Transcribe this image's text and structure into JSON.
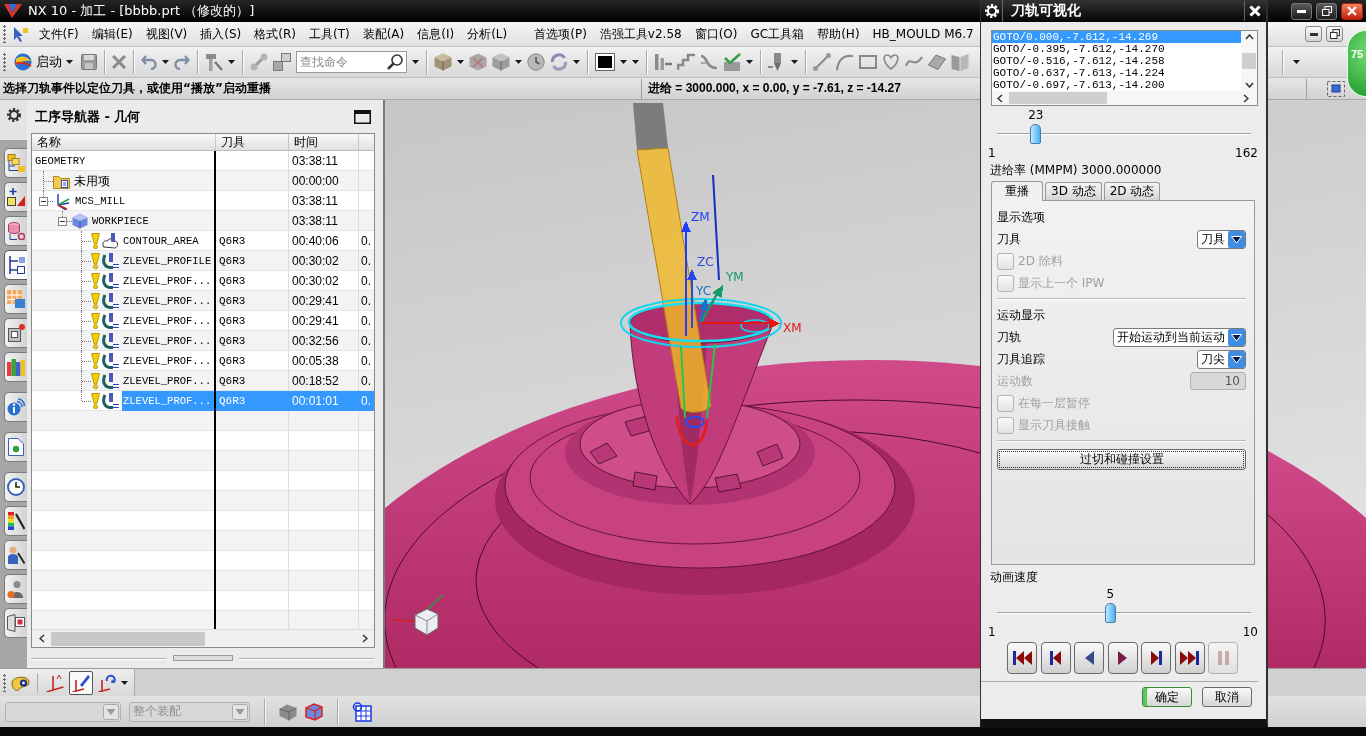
{
  "title_bar": {
    "title": "NX 10 - 加工 - [bbbb.prt （修改的）]"
  },
  "menu_bar": {
    "items": [
      "文件(F)",
      "编辑(E)",
      "视图(V)",
      "插入(S)",
      "格式(R)",
      "工具(T)",
      "装配(A)",
      "信息(I)",
      "分析(L)",
      "首选项(P)",
      "浩强工具v2.58",
      "窗口(O)",
      "GC工具箱",
      "帮助(H)",
      "HB_MOULD M6.7"
    ]
  },
  "badge": "75",
  "toolbar": {
    "start_label": "启动",
    "search": {
      "placeholder": "查找命令"
    }
  },
  "cue_line": {
    "prompt": "选择刀轨事件以定位刀具，或使用“播放”启动重播",
    "readout": "进给 = 3000.000, x = 0.00, y = -7.61, z = -14.27"
  },
  "resource_bar": {
    "groups": [
      [
        {
          "kind": "assembly",
          "selected": false
        },
        {
          "kind": "constraints",
          "selected": false
        },
        {
          "kind": "part",
          "selected": false
        },
        {
          "kind": "operation",
          "selected": true
        },
        {
          "kind": "machine",
          "selected": false
        },
        {
          "kind": "tool",
          "selected": false
        },
        {
          "kind": "library",
          "selected": false
        }
      ],
      [
        {
          "kind": "info",
          "selected": false
        }
      ],
      [
        {
          "kind": "document",
          "selected": false
        }
      ],
      [
        {
          "kind": "history",
          "selected": false
        },
        {
          "kind": "palette",
          "selected": false
        },
        {
          "kind": "role",
          "selected": false
        },
        {
          "kind": "system",
          "selected": false
        },
        {
          "kind": "web",
          "selected": false
        }
      ]
    ]
  },
  "navigator": {
    "title": "工序导航器 - 几何",
    "columns": [
      "名称",
      "刀具",
      "时间"
    ],
    "rows": [
      {
        "name": "GEOMETRY",
        "time": "03:38:11",
        "selected": false,
        "children": [
          {
            "kind": "folder",
            "name": "未用项",
            "time": "00:00:00",
            "selected": false
          },
          {
            "kind": "mcs",
            "name": "MCS_MILL",
            "time": "03:38:11",
            "expanded": true,
            "selected": false,
            "children": [
              {
                "kind": "workpiece",
                "name": "WORKPIECE",
                "time": "03:38:11",
                "expanded": true,
                "selected": false,
                "children": [
                  {
                    "kind": "contour_area",
                    "name": "CONTOUR_AREA",
                    "tool": "Q6R3",
                    "time": "00:40:06",
                    "column_4": "0.",
                    "selected": false
                  },
                  {
                    "kind": "zlevel",
                    "name": "ZLEVEL_PROFILE",
                    "tool": "Q6R3",
                    "time": "00:30:02",
                    "column_4": "0.",
                    "selected": false
                  },
                  {
                    "kind": "zlevel",
                    "name": "ZLEVEL_PROF...",
                    "tool": "Q6R3",
                    "time": "00:30:02",
                    "column_4": "0.",
                    "selected": false
                  },
                  {
                    "kind": "zlevel",
                    "name": "ZLEVEL_PROF...",
                    "tool": "Q6R3",
                    "time": "00:29:41",
                    "column_4": "0.",
                    "selected": false
                  },
                  {
                    "kind": "zlevel",
                    "name": "ZLEVEL_PROF...",
                    "tool": "Q6R3",
                    "time": "00:29:41",
                    "column_4": "0.",
                    "selected": false
                  },
                  {
                    "kind": "zlevel",
                    "name": "ZLEVEL_PROF...",
                    "tool": "Q6R3",
                    "time": "00:32:56",
                    "column_4": "0.",
                    "selected": false
                  },
                  {
                    "kind": "zlevel",
                    "name": "ZLEVEL_PROF...",
                    "tool": "Q6R3",
                    "time": "00:05:38",
                    "column_4": "0.",
                    "selected": false
                  },
                  {
                    "kind": "zlevel",
                    "name": "ZLEVEL_PROF...",
                    "tool": "Q6R3",
                    "time": "00:18:52",
                    "column_4": "0.",
                    "selected": false
                  },
                  {
                    "kind": "zlevel",
                    "name": "ZLEVEL_PROF...",
                    "tool": "Q6R3",
                    "time": "00:01:01",
                    "column_4": "0.",
                    "selected": true
                  }
                ]
              }
            ]
          }
        ]
      }
    ]
  },
  "viewport": {
    "axes": [
      {
        "label": "ZM",
        "color": "#1f3cff"
      },
      {
        "label": "ZC",
        "color": "#2a48e8"
      },
      {
        "label": "YM",
        "color": "#159a6a"
      },
      {
        "label": "YC",
        "color": "#1a70c8"
      },
      {
        "label": "XM",
        "color": "#e01818"
      }
    ]
  },
  "view_toolbar": {
    "tools": [
      {
        "kind": "palette",
        "selected": false
      },
      {
        "kind": "wcs",
        "selected": false
      },
      {
        "kind": "wcs_dynamic",
        "selected": true
      },
      {
        "kind": "wcs_rotate",
        "selected": false
      }
    ]
  },
  "selection_bar": {
    "filters": [
      {
        "disabled": true
      },
      {
        "value": "整个装配",
        "disabled": true
      }
    ]
  },
  "dialog": {
    "title": "刀轨可视化",
    "motions": [
      {
        "text": "GOTO/0.000,-7.612,-14.269",
        "selected": true
      },
      {
        "text": "GOTO/-0.395,-7.612,-14.270",
        "selected": false
      },
      {
        "text": "GOTO/-0.516,-7.612,-14.258",
        "selected": false
      },
      {
        "text": "GOTO/-0.637,-7.613,-14.224",
        "selected": false
      },
      {
        "text": "GOTO/-0.697,-7.613,-14.200",
        "selected": false
      }
    ],
    "motion_slider": {
      "value": "23",
      "min": "1",
      "max": "162",
      "level": 0.137
    },
    "feed_rate": "进给率 (MMPM) 3000.000000",
    "tabs": [
      {
        "label": "重播",
        "selected": true
      },
      {
        "label": "3D 动态",
        "selected": false
      },
      {
        "label": "2D 动态",
        "selected": false
      }
    ],
    "panel": [
      {
        "kind": "heading",
        "label": "显示选项"
      },
      {
        "kind": "select",
        "label": "刀具",
        "value": "刀具",
        "disabled": false
      },
      {
        "kind": "checkbox",
        "label": "2D 除料",
        "checked": false,
        "disabled": true
      },
      {
        "kind": "checkbox",
        "label": "显示上一个 IPW",
        "checked": false,
        "disabled": true
      },
      {
        "kind": "separator"
      },
      {
        "kind": "heading",
        "label": "运动显示"
      },
      {
        "kind": "select",
        "label": "刀轨",
        "value": "开始运动到当前运动",
        "disabled": false
      },
      {
        "kind": "select",
        "label": "刀具追踪",
        "value": "刀尖",
        "disabled": false
      },
      {
        "kind": "number",
        "label": "运动数",
        "value": "10",
        "disabled": true
      },
      {
        "kind": "checkbox",
        "label": "在每一层暂停",
        "checked": false,
        "disabled": true
      },
      {
        "kind": "checkbox",
        "label": "显示刀具接触",
        "checked": false,
        "disabled": true
      },
      {
        "kind": "separator"
      },
      {
        "kind": "button",
        "label": "过切和碰撞设置"
      }
    ],
    "speed_label": "动画速度",
    "speed_slider": {
      "value": "5",
      "min": "1",
      "max": "10",
      "level": 0.444
    },
    "playback": [
      {
        "kind": "first",
        "disabled": false
      },
      {
        "kind": "step_back",
        "disabled": false
      },
      {
        "kind": "reverse",
        "disabled": false
      },
      {
        "kind": "play",
        "disabled": false
      },
      {
        "kind": "step_forward",
        "disabled": false
      },
      {
        "kind": "last",
        "disabled": false
      },
      {
        "kind": "pause",
        "disabled": true
      }
    ],
    "buttons": [
      {
        "kind": "confirm",
        "label": "确定"
      },
      {
        "kind": "cancel",
        "label": "取消"
      }
    ]
  }
}
